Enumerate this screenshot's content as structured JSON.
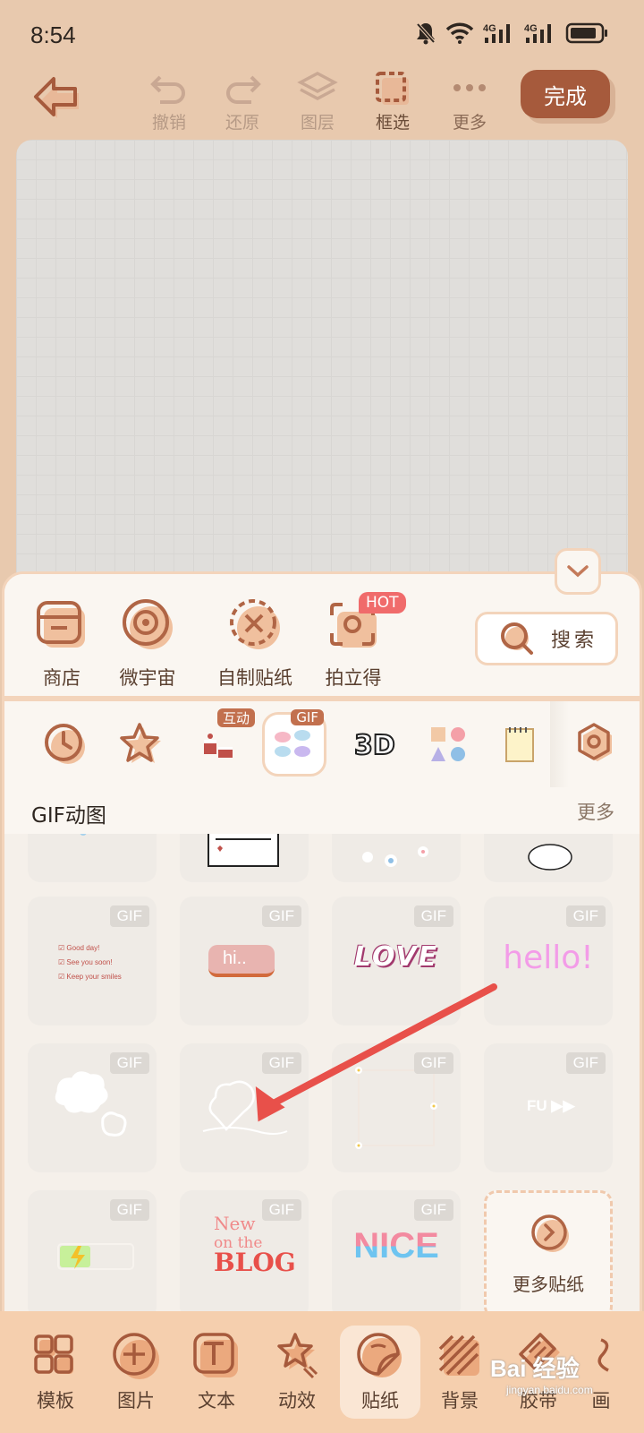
{
  "status": {
    "time": "8:54",
    "signal1": "4G",
    "signal2": "4G"
  },
  "toolbar": {
    "undo": "撤销",
    "redo": "还原",
    "layers": "图层",
    "select": "框选",
    "more": "更多",
    "done": "完成"
  },
  "categories": [
    {
      "label": "商店",
      "icon": "store-icon"
    },
    {
      "label": "微宇宙",
      "icon": "universe-icon"
    },
    {
      "label": "自制贴纸",
      "icon": "diy-sticker-icon"
    },
    {
      "label": "拍立得",
      "icon": "instant-camera-icon"
    }
  ],
  "hot_badge": "HOT",
  "search_label": "搜索",
  "tabs": [
    {
      "icon": "clock-icon"
    },
    {
      "icon": "star-icon"
    },
    {
      "icon": "cake-icon",
      "badge": "互动"
    },
    {
      "icon": "gif-pack-icon",
      "badge": "GIF"
    },
    {
      "icon": "3d-letters-icon"
    },
    {
      "icon": "shapes-icon"
    },
    {
      "icon": "notepad-icon"
    },
    {
      "icon": "hexagon-settings-icon"
    }
  ],
  "section": {
    "title": "GIF动图",
    "more": "更多"
  },
  "gif_tag": "GIF",
  "stickers": {
    "checklist": [
      "Good day!",
      "See you soon!",
      "Keep your smiles"
    ],
    "hi": "hi..",
    "love": "LOVE",
    "hello": "hello!",
    "fu": "FU ▶▶",
    "blog": [
      "New",
      "on the",
      "BLOG"
    ],
    "nice": "NICE"
  },
  "more_stickers": "更多贴纸",
  "nav": [
    {
      "label": "模板",
      "icon": "template-icon"
    },
    {
      "label": "图片",
      "icon": "add-image-icon"
    },
    {
      "label": "文本",
      "icon": "text-icon"
    },
    {
      "label": "动效",
      "icon": "effects-icon"
    },
    {
      "label": "贴纸",
      "icon": "sticker-icon"
    },
    {
      "label": "背景",
      "icon": "background-icon"
    },
    {
      "label": "胶带",
      "icon": "tape-icon"
    },
    {
      "label": "画",
      "icon": "draw-icon"
    }
  ],
  "watermark": {
    "brand": "Bai 经验",
    "url": "jingyan.baidu.com"
  },
  "colors": {
    "accent": "#a65a3c",
    "sheet_bg": "#faf6f1",
    "nav_bg": "#f5cfae",
    "arrow": "#e8504a"
  }
}
